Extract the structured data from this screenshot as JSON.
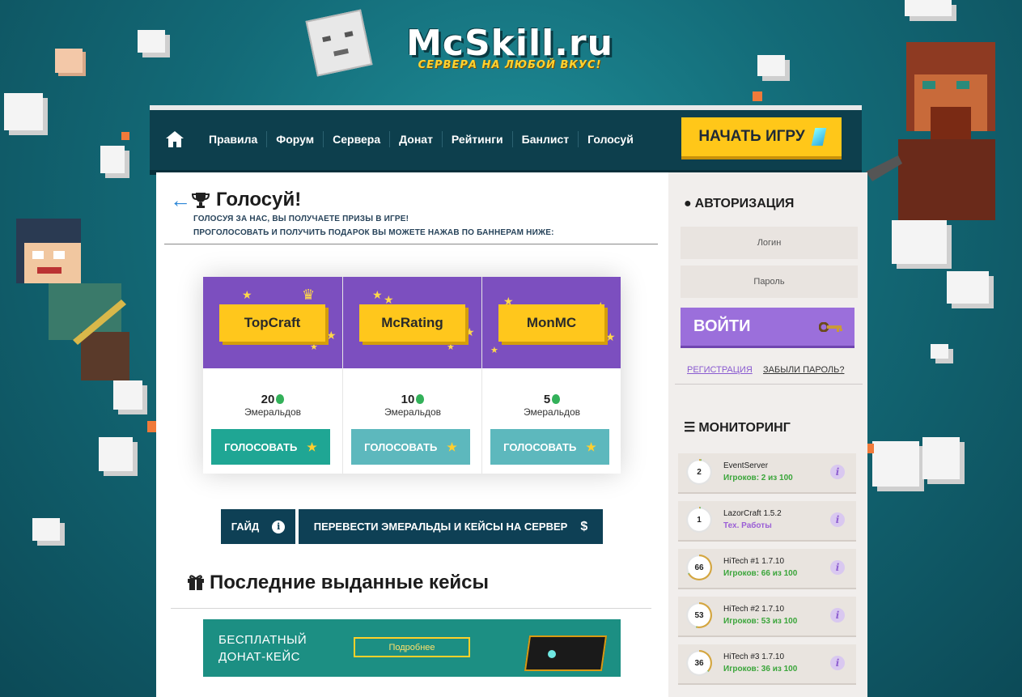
{
  "brand": {
    "logo": "McSkill.ru",
    "tagline": "СЕРВЕРА НА ЛЮБОЙ ВКУС!"
  },
  "nav": {
    "items": [
      "Правила",
      "Форум",
      "Сервера",
      "Донат",
      "Рейтинги",
      "Банлист",
      "Голосуй"
    ],
    "start_button": "НАЧАТЬ ИГРУ"
  },
  "page": {
    "title": "Голосуй!",
    "subtitle_1": "ГОЛОСУЯ ЗА НАС, ВЫ ПОЛУЧАЕТЕ ПРИЗЫ В ИГРЕ!",
    "subtitle_2": "ПРОГОЛОСОВАТЬ И ПОЛУЧИТЬ ПОДАРОК ВЫ МОЖЕТЕ НАЖАВ ПО БАННЕРАМ НИЖЕ:"
  },
  "vote": {
    "sites": [
      {
        "name": "TopCraft",
        "reward": "20",
        "unit": "Эмеральдов",
        "button": "ГОЛОСОВАТЬ"
      },
      {
        "name": "McRating",
        "reward": "10",
        "unit": "Эмеральдов",
        "button": "ГОЛОСОВАТЬ"
      },
      {
        "name": "MonMC",
        "reward": "5",
        "unit": "Эмеральдов",
        "button": "ГОЛОСОВАТЬ"
      }
    ]
  },
  "actions": {
    "guide": "ГАЙД",
    "transfer": "ПЕРЕВЕСТИ ЭМЕРАЛЬДЫ И КЕЙСЫ НА СЕРВЕР"
  },
  "cases": {
    "title": "Последние выданные кейсы",
    "banner_line_1": "БЕСПЛАТНЫЙ",
    "banner_line_2": "ДОНАТ-КЕЙС",
    "more_button": "Подробнее"
  },
  "auth": {
    "title": "АВТОРИЗАЦИЯ",
    "login_placeholder": "Логин",
    "password_placeholder": "Пароль",
    "login_button": "ВОЙТИ",
    "register_link": "РЕГИСТРАЦИЯ",
    "forgot_link": "ЗАБЫЛИ ПАРОЛЬ?"
  },
  "monitoring": {
    "title": "МОНИТОРИНГ",
    "servers": [
      {
        "name": "EventServer",
        "online": "2",
        "status": "Игроков: 2 из 100",
        "status_color": "#3aa53a",
        "fill": 0.02
      },
      {
        "name": "LazorCraft 1.5.2",
        "online": "1",
        "status": "Тех. Работы",
        "status_color": "#9b5fd6",
        "fill": 0.01
      },
      {
        "name": "HiTech #1 1.7.10",
        "online": "66",
        "status": "Игроков: 66 из 100",
        "status_color": "#3aa53a",
        "fill": 0.66
      },
      {
        "name": "HiTech #2 1.7.10",
        "online": "53",
        "status": "Игроков: 53 из 100",
        "status_color": "#3aa53a",
        "fill": 0.53
      },
      {
        "name": "HiTech #3 1.7.10",
        "online": "36",
        "status": "Игроков: 36 из 100",
        "status_color": "#3aa53a",
        "fill": 0.36
      }
    ]
  },
  "colors": {
    "nav_bg": "#0d3f4d",
    "accent_yellow": "#ffc719",
    "vote_purple": "#7c4fbf",
    "button_teal": "#5db8bd",
    "button_teal_active": "#1fa694",
    "login_purple": "#9b6fdb"
  }
}
